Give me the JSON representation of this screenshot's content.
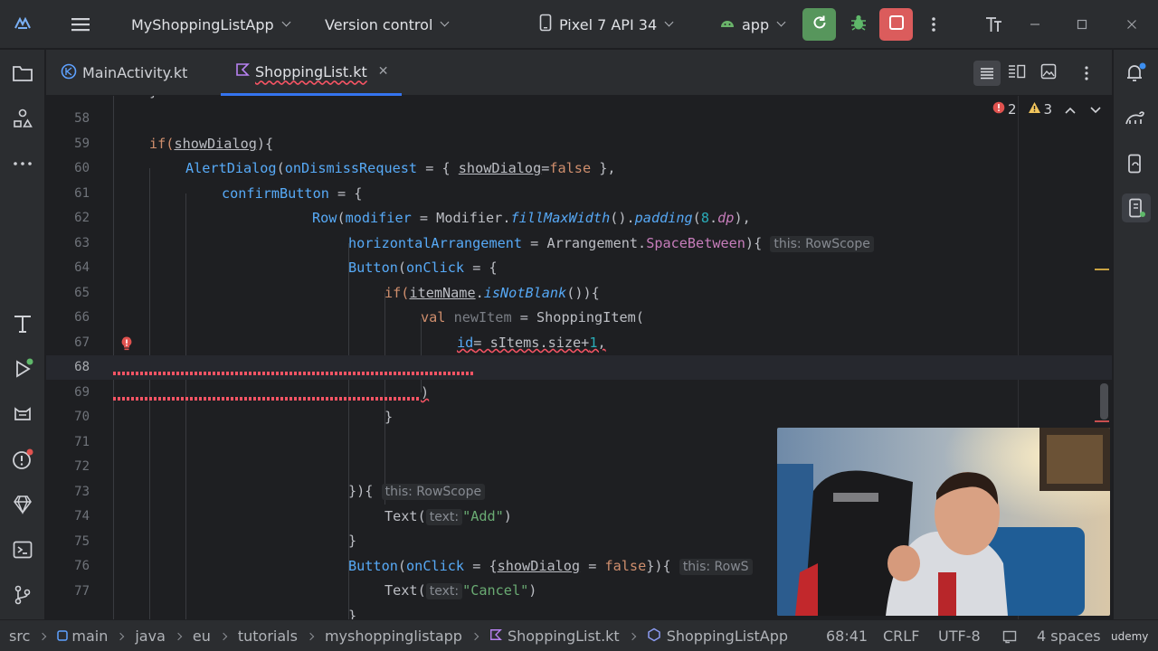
{
  "titlebar": {
    "project": "MyShoppingListApp",
    "vcs": "Version control",
    "device": "Pixel 7 API 34",
    "config": "app",
    "colors": {
      "run": "#57965c",
      "stop": "#db5c5c"
    }
  },
  "tabs": [
    {
      "label": "MainActivity.kt"
    },
    {
      "label": "ShoppingList.kt"
    }
  ],
  "inspections": {
    "errors": "2",
    "warnings": "3"
  },
  "code": {
    "line_numbers": [
      "58",
      "59",
      "60",
      "61",
      "62",
      "63",
      "64",
      "65",
      "66",
      "67",
      "68",
      "69",
      "70",
      "71",
      "72",
      "73",
      "74",
      "75",
      "76",
      "77"
    ],
    "l59": {
      "a": "if(",
      "b": "showDialog",
      "c": "){"
    },
    "l60": {
      "a": "AlertDialog",
      "b": "(",
      "c": "onDismissRequest",
      "d": " = { ",
      "e": "showDialog",
      "f": "=",
      "g": "false",
      "h": " },"
    },
    "l61": {
      "a": "confirmButton",
      "b": " = {"
    },
    "l62": {
      "a": "Row",
      "b": "(",
      "c": "modifier",
      "d": " = Modifier.",
      "e": "fillMaxWidth",
      "f": "().",
      "g": "padding",
      "h": "(",
      "i": "8",
      "j": ".",
      "k": "dp",
      "l": "),"
    },
    "l63": {
      "a": "horizontalArrangement",
      "b": " = Arrangement.",
      "c": "SpaceBetween",
      "d": "){",
      "hint": "this: RowScope"
    },
    "l64": {
      "a": "Button",
      "b": "(",
      "c": "onClick",
      "d": " = {"
    },
    "l65": {
      "a": "if(",
      "b": "itemName",
      "c": ".",
      "d": "isNotBlank",
      "e": "()){"
    },
    "l66": {
      "a": "val ",
      "b": "newItem",
      "c": " = ShoppingItem("
    },
    "l67": {
      "a": "id",
      "b": "= sItems.size+",
      "c": "1",
      "d": ","
    },
    "l69": {
      "a": ")"
    },
    "l70": {
      "a": "}"
    },
    "l73": {
      "a": "}){",
      "hint": "this: RowScope"
    },
    "l74": {
      "a": "Text(",
      "hint": "text:",
      "b": "\"Add\"",
      "c": ")"
    },
    "l75": {
      "a": "}"
    },
    "l76": {
      "a": "Button",
      "b": "(",
      "c": "onClick",
      "d": " = {",
      "e": "showDialog",
      "f": " = ",
      "g": "false",
      "h": "}){",
      "hint": "this: RowS"
    },
    "l77": {
      "a": "Text(",
      "hint": "text:",
      "b": "\"Cancel\"",
      "c": ")"
    }
  },
  "statusbar": {
    "crumbs": [
      "src",
      "main",
      "java",
      "eu",
      "tutorials",
      "myshoppinglistapp",
      "ShoppingList.kt",
      "ShoppingListApp"
    ],
    "position": "68:41",
    "line_sep": "CRLF",
    "encoding": "UTF-8",
    "indent": "4 spaces",
    "watermark": "udemy"
  },
  "icons": [
    "app-logo-icon",
    "hamburger-menu-icon",
    "device-icon",
    "android-icon",
    "rerun-icon",
    "debug-icon",
    "stop-icon",
    "more-vert-icon",
    "text-tool-icon",
    "minimize-icon",
    "maximize-icon",
    "close-icon",
    "folder-icon",
    "structure-icon",
    "more-icon",
    "build-icon",
    "run-icon",
    "logcat-icon",
    "problems-icon",
    "gem-icon",
    "terminal-icon",
    "git-icon",
    "notifications-icon",
    "gradle-icon",
    "device-manager-icon",
    "running-devices-icon",
    "kotlin-file-icon",
    "error-icon",
    "warning-icon"
  ]
}
